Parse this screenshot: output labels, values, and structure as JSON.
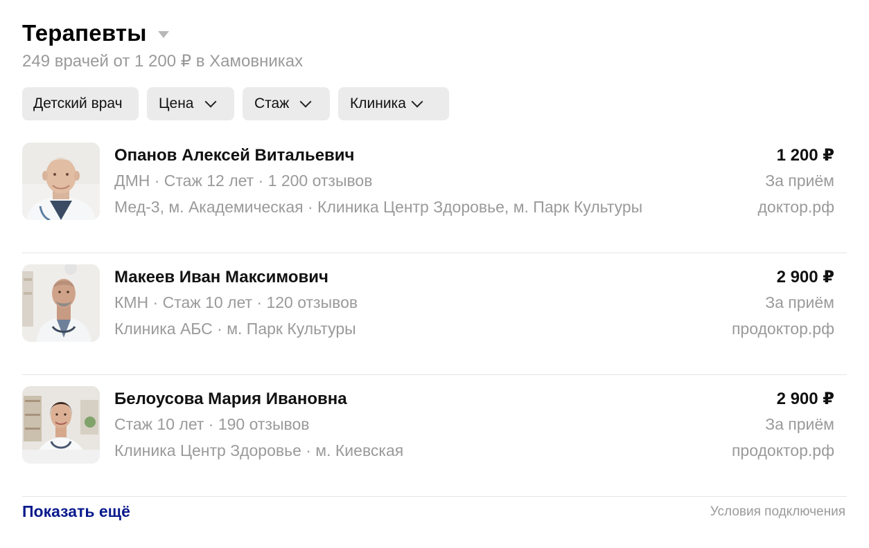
{
  "header": {
    "title": "Терапевты",
    "subtitle": "249 врачей от 1 200 ₽ в Хамовниках"
  },
  "filters": {
    "child": "Детский врач",
    "price": "Цена",
    "experience": "Стаж",
    "clinic": "Клиника"
  },
  "doctors": [
    {
      "name": "Опанов Алексей Витальевич",
      "meta1": "ДМН · Стаж 12 лет · 1 200 отзывов",
      "meta2": "Мед-3, м. Академическая · Клиника Центр Здоровье, м. Парк Культуры",
      "price": "1 200 ₽",
      "price_note": "За приём",
      "source": "доктор.рф"
    },
    {
      "name": "Макеев Иван Максимович",
      "meta1": "КМН · Стаж 10 лет · 120 отзывов",
      "meta2": "Клиника АБС · м. Парк Культуры",
      "price": "2 900 ₽",
      "price_note": "За приём",
      "source": "продоктор.рф"
    },
    {
      "name": "Белоусова Мария Ивановна",
      "meta1": "Стаж 10 лет · 190 отзывов",
      "meta2": "Клиника Центр Здоровье · м. Киевская",
      "price": "2 900 ₽",
      "price_note": "За приём",
      "source": "продоктор.рф"
    }
  ],
  "footer": {
    "show_more": "Показать ещё",
    "terms": "Условия подключения"
  },
  "colors": {
    "link": "#0a1a8c",
    "muted": "#9a9a9a",
    "chip_bg": "#ebebeb",
    "divider": "#e4e4e4"
  }
}
